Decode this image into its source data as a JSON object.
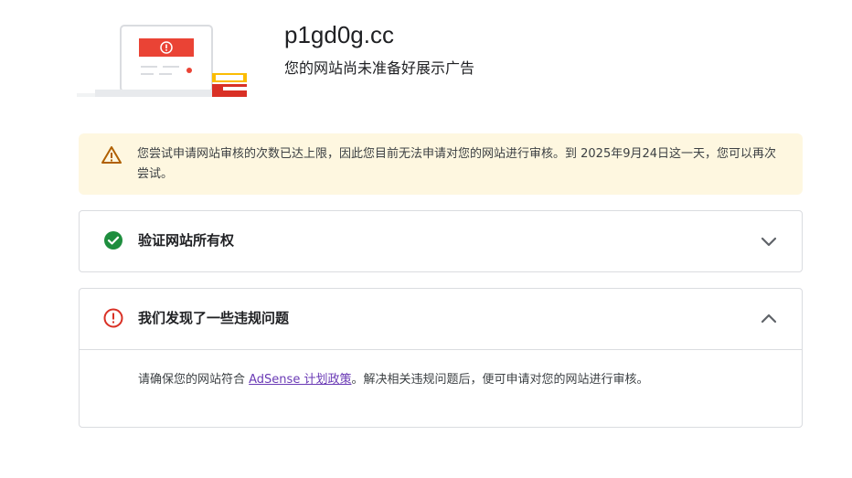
{
  "header": {
    "site_name": "p1gd0g.cc",
    "status_text": "您的网站尚未准备好展示广告"
  },
  "warning": {
    "icon": "warning-icon",
    "text": "您尝试申请网站审核的次数已达上限，因此您目前无法申请对您的网站进行审核。到 2025年9月24日这一天，您可以再次尝试。"
  },
  "panels": [
    {
      "title": "验证网站所有权",
      "icon": "check-circle-icon",
      "icon_color": "#1e8e3e",
      "chevron": "chevron-down-icon",
      "expanded": false
    },
    {
      "title": "我们发现了一些违规问题",
      "icon": "error-circle-icon",
      "icon_color": "#d93025",
      "chevron": "chevron-up-icon",
      "expanded": true,
      "body": {
        "prefix": "请确保您的网站符合 ",
        "link": "AdSense 计划政策",
        "suffix": "。解决相关违规问题后，便可申请对您的网站进行审核。"
      }
    }
  ],
  "colors": {
    "warning_bg": "#fef7e0",
    "warning_icon": "#b06000",
    "success": "#1e8e3e",
    "error": "#d93025",
    "link": "#6a3ab5",
    "border": "#dadce0"
  }
}
